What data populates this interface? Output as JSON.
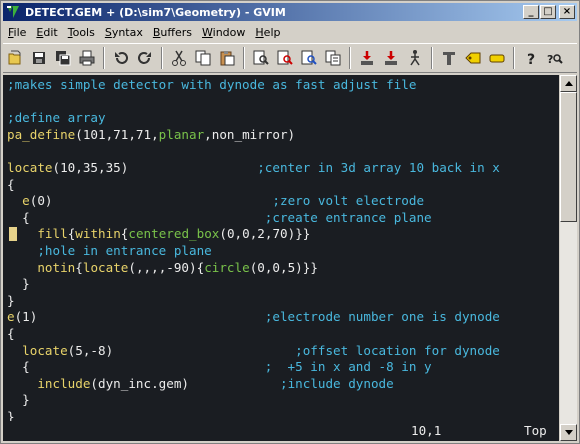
{
  "window": {
    "title": "DETECT.GEM + (D:\\sim7\\Geometry) - GVIM",
    "buttons": {
      "minimize": "_",
      "maximize": "□",
      "close": "×"
    }
  },
  "menubar": [
    {
      "label": "File",
      "accel": "F",
      "rest": "ile"
    },
    {
      "label": "Edit",
      "accel": "E",
      "rest": "dit"
    },
    {
      "label": "Tools",
      "accel": "T",
      "rest": "ools"
    },
    {
      "label": "Syntax",
      "accel": "S",
      "rest": "yntax"
    },
    {
      "label": "Buffers",
      "accel": "B",
      "rest": "uffers"
    },
    {
      "label": "Window",
      "accel": "W",
      "rest": "indow"
    },
    {
      "label": "Help",
      "accel": "H",
      "rest": "elp"
    }
  ],
  "toolbar_icons": [
    "open-icon",
    "save-icon",
    "save-all-icon",
    "print-icon",
    "undo-icon",
    "redo-icon",
    "cut-icon",
    "copy-icon",
    "paste-icon",
    "find-replace-icon",
    "find-next-icon",
    "find-prev-icon",
    "load-session-icon",
    "save-session-icon",
    "run-script-icon",
    "make-icon",
    "shell-icon",
    "ctags-icon",
    "help-icon",
    "find-help-icon"
  ],
  "editor": {
    "lines": [
      [
        [
          "c-comment",
          ";makes simple detector with dynode as fast adjust file"
        ]
      ],
      [
        [
          "c-plain",
          ""
        ]
      ],
      [
        [
          "c-comment",
          ";define array"
        ]
      ],
      [
        [
          "c-fn",
          "pa_define"
        ],
        [
          "c-plain",
          "(101,71,71,"
        ],
        [
          "c-green",
          "planar"
        ],
        [
          "c-plain",
          ",non_mirror)"
        ]
      ],
      [
        [
          "c-plain",
          ""
        ]
      ],
      [
        [
          "c-fn",
          "locate"
        ],
        [
          "c-plain",
          "(10,35,35)                 "
        ],
        [
          "c-comment",
          ";center in 3d array 10 back in x"
        ]
      ],
      [
        [
          "c-plain",
          "{"
        ]
      ],
      [
        [
          "c-plain",
          "  "
        ],
        [
          "c-fn",
          "e"
        ],
        [
          "c-plain",
          "(0)                             "
        ],
        [
          "c-comment",
          ";zero volt electrode"
        ]
      ],
      [
        [
          "c-plain",
          "  {                               "
        ],
        [
          "c-comment",
          ";create entrance plane"
        ]
      ],
      [
        [
          "c-plain",
          "    "
        ],
        [
          "c-fn",
          "fill"
        ],
        [
          "c-plain",
          "{"
        ],
        [
          "c-fn",
          "within"
        ],
        [
          "c-plain",
          "{"
        ],
        [
          "c-green",
          "centered_box"
        ],
        [
          "c-plain",
          "(0,0,2,70)}}"
        ]
      ],
      [
        [
          "c-plain",
          "    "
        ],
        [
          "c-comment",
          ";hole in entrance plane"
        ]
      ],
      [
        [
          "c-plain",
          "    "
        ],
        [
          "c-fn",
          "notin"
        ],
        [
          "c-plain",
          "{"
        ],
        [
          "c-fn",
          "locate"
        ],
        [
          "c-plain",
          "(,,,,-90){"
        ],
        [
          "c-green",
          "circle"
        ],
        [
          "c-plain",
          "(0,0,5)}}"
        ]
      ],
      [
        [
          "c-plain",
          "  }"
        ]
      ],
      [
        [
          "c-plain",
          "}"
        ]
      ],
      [
        [
          "c-fn",
          "e"
        ],
        [
          "c-plain",
          "(1)                              "
        ],
        [
          "c-comment",
          ";electrode number one is dynode"
        ]
      ],
      [
        [
          "c-plain",
          "{"
        ]
      ],
      [
        [
          "c-plain",
          "  "
        ],
        [
          "c-fn",
          "locate"
        ],
        [
          "c-plain",
          "(5,-8)                        "
        ],
        [
          "c-comment",
          ";offset location for dynode"
        ]
      ],
      [
        [
          "c-plain",
          "  {                               "
        ],
        [
          "c-comment",
          ";  +5 in x and -8 in y"
        ]
      ],
      [
        [
          "c-plain",
          "    "
        ],
        [
          "c-fn",
          "include"
        ],
        [
          "c-plain",
          "(dyn_inc.gem)            "
        ],
        [
          "c-comment",
          ";include dynode"
        ]
      ],
      [
        [
          "c-plain",
          "  }"
        ]
      ],
      [
        [
          "c-plain",
          "}"
        ]
      ]
    ],
    "cursor_line": 10
  },
  "status": {
    "position": "10,1",
    "scroll": "Top"
  },
  "colors": {
    "background": "#1a1d22",
    "comment": "#49b8de",
    "function": "#e8d36a",
    "keyword": "#79c24a",
    "title_start": "#0a246a",
    "title_end": "#a6caf0"
  }
}
